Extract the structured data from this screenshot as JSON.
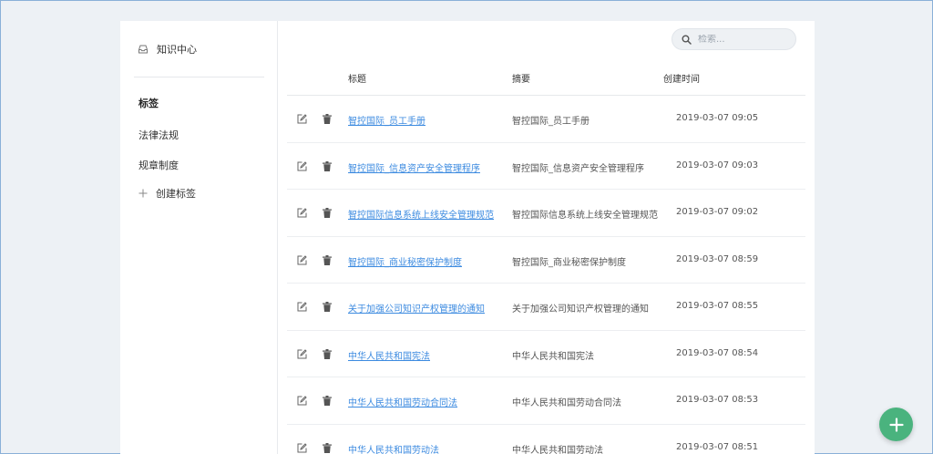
{
  "sidebar": {
    "brand": {
      "icon": "inbox-icon",
      "label": "知识中心"
    },
    "section_title": "标签",
    "tags": [
      {
        "label": "法律法规"
      },
      {
        "label": "规章制度"
      }
    ],
    "create": {
      "icon": "plus-icon",
      "label": "创建标签"
    }
  },
  "search": {
    "placeholder": "检索...",
    "value": "",
    "icon": "search-icon"
  },
  "table": {
    "columns": {
      "title": "标题",
      "summary": "摘要",
      "created": "创建时间"
    },
    "rows": [
      {
        "title": "智控国际_员工手册",
        "summary": "智控国际_员工手册",
        "created": "2019-03-07 09:05"
      },
      {
        "title": "智控国际_信息资产安全管理程序",
        "summary": "智控国际_信息资产安全管理程序",
        "created": "2019-03-07 09:03"
      },
      {
        "title": "智控国际信息系统上线安全管理规范",
        "summary": "智控国际信息系统上线安全管理规范",
        "created": "2019-03-07 09:02"
      },
      {
        "title": "智控国际_商业秘密保护制度",
        "summary": "智控国际_商业秘密保护制度",
        "created": "2019-03-07 08:59"
      },
      {
        "title": "关于加强公司知识产权管理的通知",
        "summary": "关于加强公司知识产权管理的通知",
        "created": "2019-03-07 08:55"
      },
      {
        "title": "中华人民共和国宪法",
        "summary": "中华人民共和国宪法",
        "created": "2019-03-07 08:54"
      },
      {
        "title": "中华人民共和国劳动合同法",
        "summary": "中华人民共和国劳动合同法",
        "created": "2019-03-07 08:53"
      },
      {
        "title": "中华人民共和国劳动法",
        "summary": "中华人民共和国劳动法",
        "created": "2019-03-07 08:51"
      }
    ]
  },
  "fab": {
    "icon": "plus-icon"
  },
  "colors": {
    "link": "#3d8be0",
    "accent": "#4ab37e",
    "background": "#edf1f5"
  }
}
